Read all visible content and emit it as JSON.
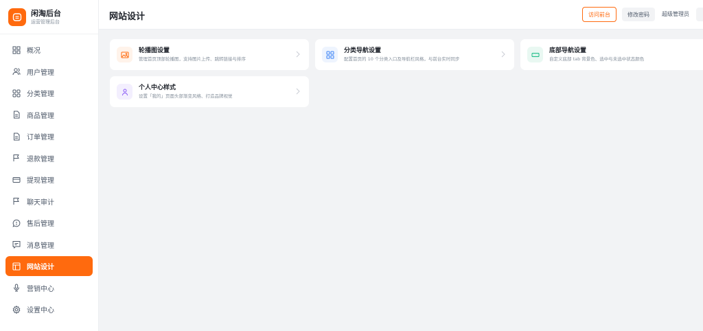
{
  "brand": {
    "title": "闲淘后台",
    "subtitle": "运营管理后台"
  },
  "nav": [
    {
      "key": "overview",
      "label": "概况",
      "icon": "grid-icon"
    },
    {
      "key": "users",
      "label": "用户管理",
      "icon": "users-icon"
    },
    {
      "key": "category",
      "label": "分类管理",
      "icon": "category-grid-icon"
    },
    {
      "key": "goods",
      "label": "商品管理",
      "icon": "document-icon"
    },
    {
      "key": "orders",
      "label": "订单管理",
      "icon": "document-icon"
    },
    {
      "key": "refund",
      "label": "退款管理",
      "icon": "flag-icon"
    },
    {
      "key": "withdraw",
      "label": "提现管理",
      "icon": "card-icon"
    },
    {
      "key": "chat",
      "label": "聊天审计",
      "icon": "flag-icon"
    },
    {
      "key": "aftersale",
      "label": "售后管理",
      "icon": "chat-bubble-icon"
    },
    {
      "key": "message",
      "label": "消息管理",
      "icon": "message-icon"
    },
    {
      "key": "website",
      "label": "网站设计",
      "icon": "layout-icon",
      "active": true
    },
    {
      "key": "marketing",
      "label": "营销中心",
      "icon": "microphone-icon"
    },
    {
      "key": "settings",
      "label": "设置中心",
      "icon": "gear-icon"
    }
  ],
  "header": {
    "title": "网站设计",
    "visit_label": "访问前台",
    "change_password_label": "修改密码",
    "user_name": "超级管理员"
  },
  "cards": [
    {
      "title": "轮播图设置",
      "desc": "管理首页顶部轮播图，支持图片上传、跳转链接与排序",
      "icon": "image-icon",
      "color": "#ff6a0e",
      "bg": "#fff3ea"
    },
    {
      "title": "分类导航设置",
      "desc": "配置首页的 10 个分类入口及导航栏风格，与前台实时同步",
      "icon": "grid-icon",
      "color": "#3b82f6",
      "bg": "#eef4fe"
    },
    {
      "title": "底部导航设置",
      "desc": "自定义底部 tab 背景色、选中与未选中状态颜色",
      "icon": "tabbar-icon",
      "color": "#10b981",
      "bg": "#e9f8f2"
    },
    {
      "title": "个人中心样式",
      "desc": "设置「我的」页面头部渐变风格、打造品牌视觉",
      "icon": "person-icon",
      "color": "#8b5cf6",
      "bg": "#f3effe"
    }
  ],
  "colors": {
    "accent": "#ff6a0e",
    "text": "#1d2129",
    "muted": "#86909c",
    "bg": "#f2f3f5"
  }
}
